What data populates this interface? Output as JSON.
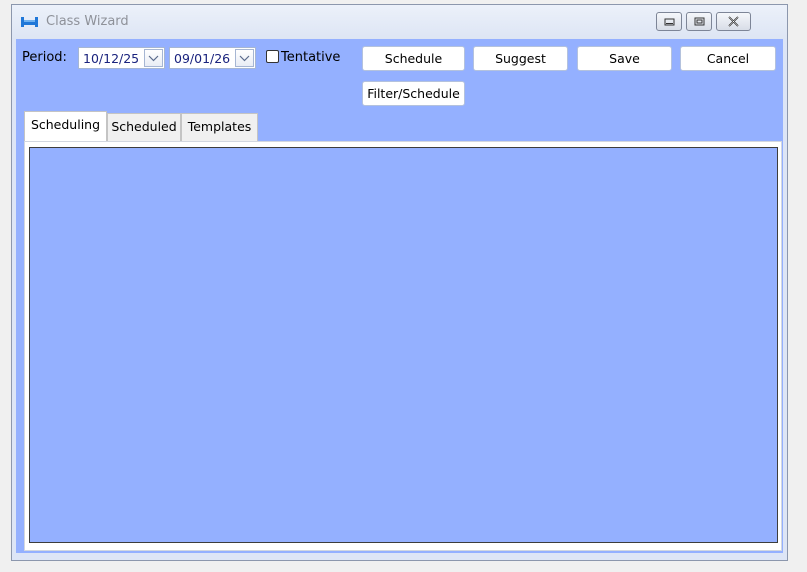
{
  "window": {
    "title": "Class Wizard",
    "controls": [
      "minimize-icon",
      "restore-icon",
      "close-icon"
    ]
  },
  "toolbar": {
    "period_label": "Period:",
    "start_date": "10/12/25",
    "end_date": "09/01/26",
    "tentative_label": "Tentative",
    "tentative_checked": false,
    "schedule_label": "Schedule",
    "suggest_label": "Suggest",
    "save_label": "Save",
    "cancel_label": "Cancel",
    "filter_schedule_label": "Filter/Schedule"
  },
  "tabs": [
    {
      "label": "Scheduling",
      "active": true
    },
    {
      "label": "Scheduled",
      "active": false
    },
    {
      "label": "Templates",
      "active": false
    }
  ],
  "colors": {
    "client_background": "#94b0ff",
    "title_text": "#8e9199",
    "date_text": "#1a237e",
    "app_icon": "#1f77d8"
  }
}
